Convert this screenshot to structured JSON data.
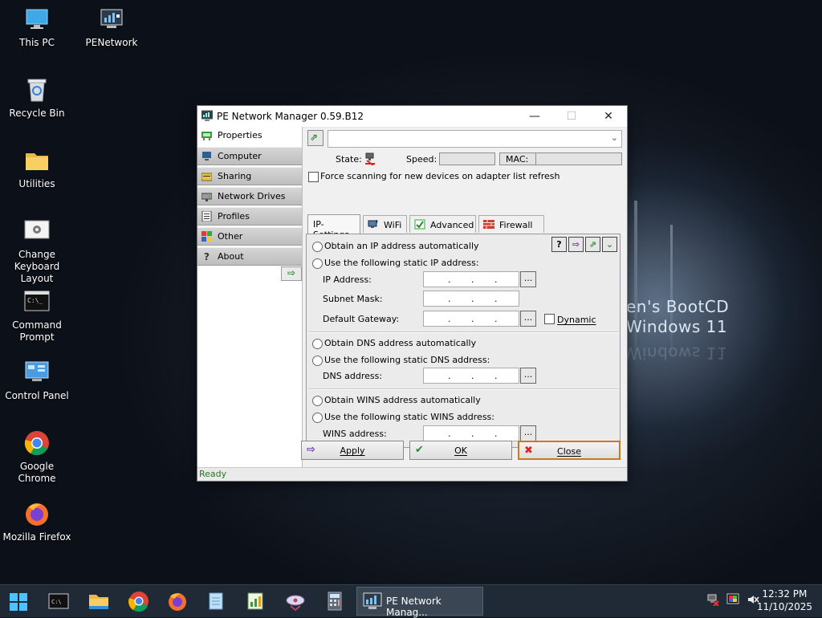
{
  "desktop": {
    "icons": [
      {
        "label": "This PC",
        "icon": "computer-icon"
      },
      {
        "label": "PENetwork",
        "icon": "network-monitor-icon"
      },
      {
        "label": "Recycle Bin",
        "icon": "recycle-bin-icon"
      },
      {
        "label": "Utilities",
        "icon": "folder-icon"
      },
      {
        "label": "Change Keyboard Layout",
        "icon": "keyboard-settings-icon"
      },
      {
        "label": "Command Prompt",
        "icon": "terminal-icon"
      },
      {
        "label": "Control Panel",
        "icon": "control-panel-icon"
      },
      {
        "label": "Google Chrome",
        "icon": "chrome-icon"
      },
      {
        "label": "Mozilla Firefox",
        "icon": "firefox-icon"
      }
    ],
    "wallpaper_text": [
      "en's BootCD",
      "Windows 11"
    ]
  },
  "window": {
    "title": "PE Network Manager 0.59.B12",
    "controls": {
      "minimize": "—",
      "maximize": "☐",
      "close": "✕"
    },
    "sidebar": {
      "items": [
        {
          "label": "Properties",
          "icon": "network-card-icon",
          "active": true
        },
        {
          "label": "Computer",
          "icon": "computer-icon",
          "active": false
        },
        {
          "label": "Sharing",
          "icon": "folder-share-icon",
          "active": false
        },
        {
          "label": "Network Drives",
          "icon": "network-drive-icon",
          "active": false
        },
        {
          "label": "Profiles",
          "icon": "profile-list-icon",
          "active": false
        },
        {
          "label": "Other",
          "icon": "colored-grid-icon",
          "active": false
        },
        {
          "label": "About",
          "icon": "help-icon",
          "active": false
        }
      ]
    },
    "adapter": {
      "selected": ""
    },
    "state_label": "State:",
    "speed_label": "Speed:",
    "speed_value": "",
    "mac_label": "MAC:",
    "mac_value": "",
    "force_scan_label": "Force scanning for new devices on adapter list refresh",
    "force_scan_checked": false,
    "tabs": [
      {
        "label": "IP-Settings",
        "active": true
      },
      {
        "label": "WiFi",
        "icon": "wifi-adapter-icon",
        "active": false
      },
      {
        "label": "Advanced",
        "icon": "gear-check-icon",
        "active": false
      },
      {
        "label": "Firewall",
        "icon": "firewall-icon",
        "active": false
      }
    ],
    "ip_settings": {
      "obtain_ip_auto": "Obtain an IP address automatically",
      "use_static_ip": "Use the following static IP address:",
      "ip_address_label": "IP Address:",
      "subnet_mask_label": "Subnet Mask:",
      "default_gateway_label": "Default Gateway:",
      "dynamic_label": "Dynamic",
      "obtain_dns_auto": "Obtain DNS address automatically",
      "use_static_dns": "Use the following static DNS address:",
      "dns_address_label": "DNS address:",
      "obtain_wins_auto": "Obtain WINS address automatically",
      "use_static_wins": "Use the following static WINS address:",
      "wins_address_label": "WINS address:",
      "ip_separator": ".",
      "ellipsis": "..."
    },
    "buttons": {
      "apply": "Apply",
      "ok": "OK",
      "close": "Close"
    },
    "status": "Ready"
  },
  "taskbar": {
    "open_window_label": "PE Network Manag...",
    "clock_time": "12:32 PM",
    "clock_date": "11/10/2025"
  },
  "colors": {
    "status_text": "#1f7a1f",
    "close_focus": "#c97a1a",
    "taskbar": "#1f2a36"
  }
}
